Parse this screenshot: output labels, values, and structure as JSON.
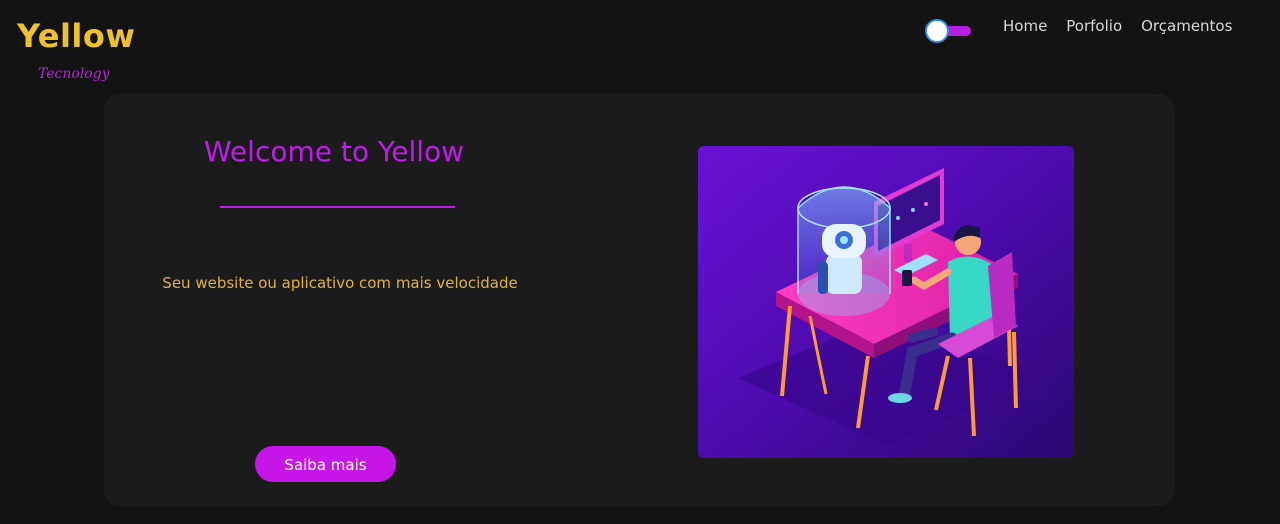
{
  "logo": {
    "title": "Yellow",
    "subtitle": "Tecnology"
  },
  "nav": {
    "items": [
      {
        "label": "Home"
      },
      {
        "label": "Porfolio"
      },
      {
        "label": "Orçamentos"
      }
    ]
  },
  "hero": {
    "title": "Welcome to Yellow",
    "text": "Seu website ou aplicativo com mais velocidade",
    "button_label": "Saiba mais"
  },
  "colors": {
    "background": "#131313",
    "card": "#1b1b1b",
    "brand_yellow": "#f0c12e",
    "brand_purple": "#c01bea",
    "button": "#c616e8"
  },
  "icons": {
    "theme_toggle": "theme-toggle",
    "illustration": "robot-desk-illustration"
  }
}
